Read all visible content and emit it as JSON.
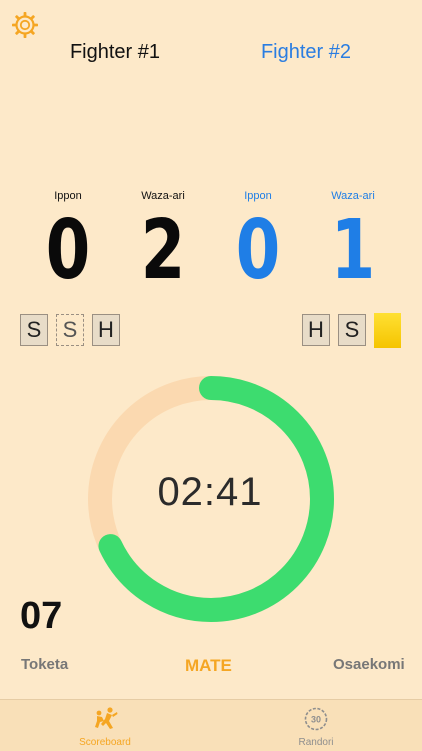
{
  "header": {
    "settings_icon": "gear-icon"
  },
  "fighters": {
    "f1": {
      "name": "Fighter #1",
      "ippon_label": "Ippon",
      "wazaari_label": "Waza-ari",
      "ippon": "0",
      "wazaari": "2",
      "penalties": [
        "S",
        "S",
        "H"
      ]
    },
    "f2": {
      "name": "Fighter #2",
      "ippon_label": "Ippon",
      "wazaari_label": "Waza-ari",
      "ippon": "0",
      "wazaari": "1",
      "penalties": [
        "H",
        "S"
      ]
    }
  },
  "timer": {
    "value": "02:41",
    "progress": 0.68,
    "progress_color": "#3ddc6f",
    "track_color": "#fbd9b0"
  },
  "osaekomi_count": "07",
  "actions": {
    "toketa": "Toketa",
    "mate": "MATE",
    "osaekomi": "Osaekomi"
  },
  "tabs": [
    {
      "label": "Scoreboard",
      "icon": "judo-throw-icon",
      "active": true
    },
    {
      "label": "Randori",
      "icon": "timer-30-icon",
      "active": false
    }
  ],
  "colors": {
    "accent": "#f5a623",
    "blue": "#1f7ee6",
    "background": "#fde9c9"
  }
}
